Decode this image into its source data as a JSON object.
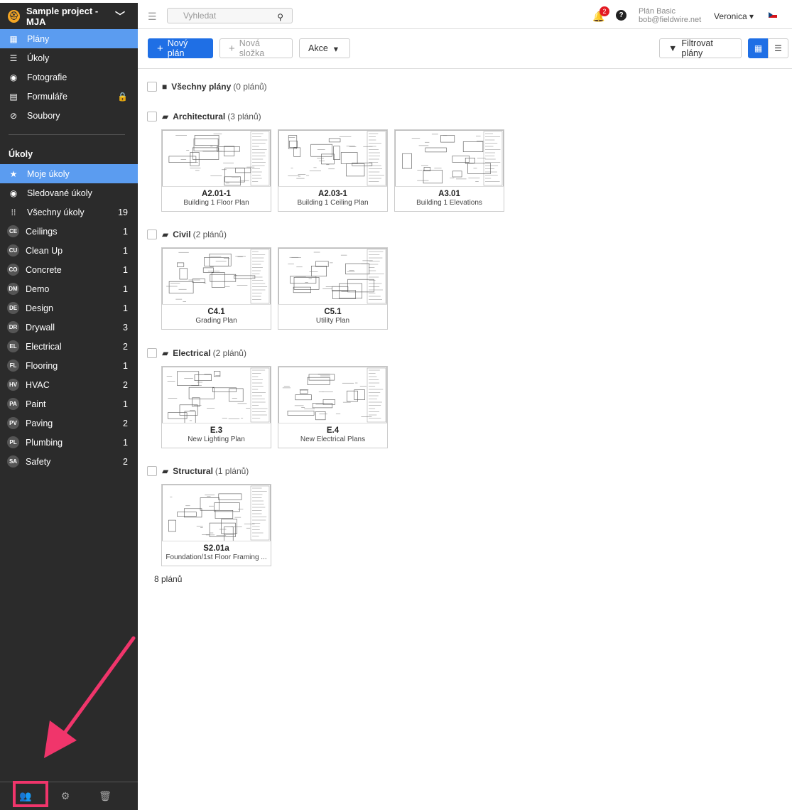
{
  "sidebar": {
    "project_name": "Sample project - MJA",
    "nav": [
      {
        "label": "Plány",
        "icon": "plans-icon",
        "glyph": "▦"
      },
      {
        "label": "Úkoly",
        "icon": "list-icon",
        "glyph": "☰"
      },
      {
        "label": "Fotografie",
        "icon": "camera-icon",
        "glyph": "◉"
      },
      {
        "label": "Formuláře",
        "icon": "clipboard-icon",
        "glyph": "▤"
      },
      {
        "label": "Soubory",
        "icon": "paperclip-icon",
        "glyph": "⊘"
      }
    ],
    "tasks_title": "Úkoly",
    "task_filters": [
      {
        "label": "Moje úkoly",
        "icon": "star-icon",
        "glyph": "★"
      },
      {
        "label": "Sledované úkoly",
        "icon": "eye-icon",
        "glyph": "◉"
      },
      {
        "label": "Všechny úkoly",
        "icon": "grid-icon",
        "glyph": "⁞⁞",
        "count": "19"
      }
    ],
    "categories": [
      {
        "abbr": "CE",
        "label": "Ceilings",
        "count": "1"
      },
      {
        "abbr": "CU",
        "label": "Clean Up",
        "count": "1"
      },
      {
        "abbr": "CO",
        "label": "Concrete",
        "count": "1"
      },
      {
        "abbr": "DM",
        "label": "Demo",
        "count": "1"
      },
      {
        "abbr": "DE",
        "label": "Design",
        "count": "1"
      },
      {
        "abbr": "DR",
        "label": "Drywall",
        "count": "3"
      },
      {
        "abbr": "EL",
        "label": "Electrical",
        "count": "2"
      },
      {
        "abbr": "FL",
        "label": "Flooring",
        "count": "1"
      },
      {
        "abbr": "HV",
        "label": "HVAC",
        "count": "2"
      },
      {
        "abbr": "PA",
        "label": "Paint",
        "count": "1"
      },
      {
        "abbr": "PV",
        "label": "Paving",
        "count": "2"
      },
      {
        "abbr": "PL",
        "label": "Plumbing",
        "count": "1"
      },
      {
        "abbr": "SA",
        "label": "Safety",
        "count": "2"
      }
    ]
  },
  "topbar": {
    "search_placeholder": "Vyhledat",
    "notification_count": "2",
    "plan_name": "Plán Basic",
    "email": "bob@fieldwire.net",
    "user": "Veronica"
  },
  "toolbar": {
    "new_plan": "Nový plán",
    "new_folder": "Nová složka",
    "actions": "Akce",
    "filter": "Filtrovat plány"
  },
  "folders": [
    {
      "name": "Všechny plány",
      "count": "(0 plánů)",
      "plans": []
    },
    {
      "name": "Architectural",
      "count": "(3 plánů)",
      "plans": [
        {
          "code": "A2.01-1",
          "title": "Building 1 Floor Plan"
        },
        {
          "code": "A2.03-1",
          "title": "Building 1 Ceiling Plan"
        },
        {
          "code": "A3.01",
          "title": "Building 1 Elevations"
        }
      ]
    },
    {
      "name": "Civil",
      "count": "(2 plánů)",
      "plans": [
        {
          "code": "C4.1",
          "title": "Grading Plan"
        },
        {
          "code": "C5.1",
          "title": "Utility Plan"
        }
      ]
    },
    {
      "name": "Electrical",
      "count": "(2 plánů)",
      "plans": [
        {
          "code": "E.3",
          "title": "New Lighting Plan"
        },
        {
          "code": "E.4",
          "title": "New Electrical Plans"
        }
      ]
    },
    {
      "name": "Structural",
      "count": "(1 plánů)",
      "plans": [
        {
          "code": "S2.01a",
          "title": "Foundation/1st Floor Framing ..."
        }
      ]
    }
  ],
  "total": "8 plánů",
  "colors": {
    "accent": "#1f6fe5",
    "sidebar": "#2b2b2b",
    "active": "#5b9cf0",
    "annotation": "#f0356b"
  }
}
